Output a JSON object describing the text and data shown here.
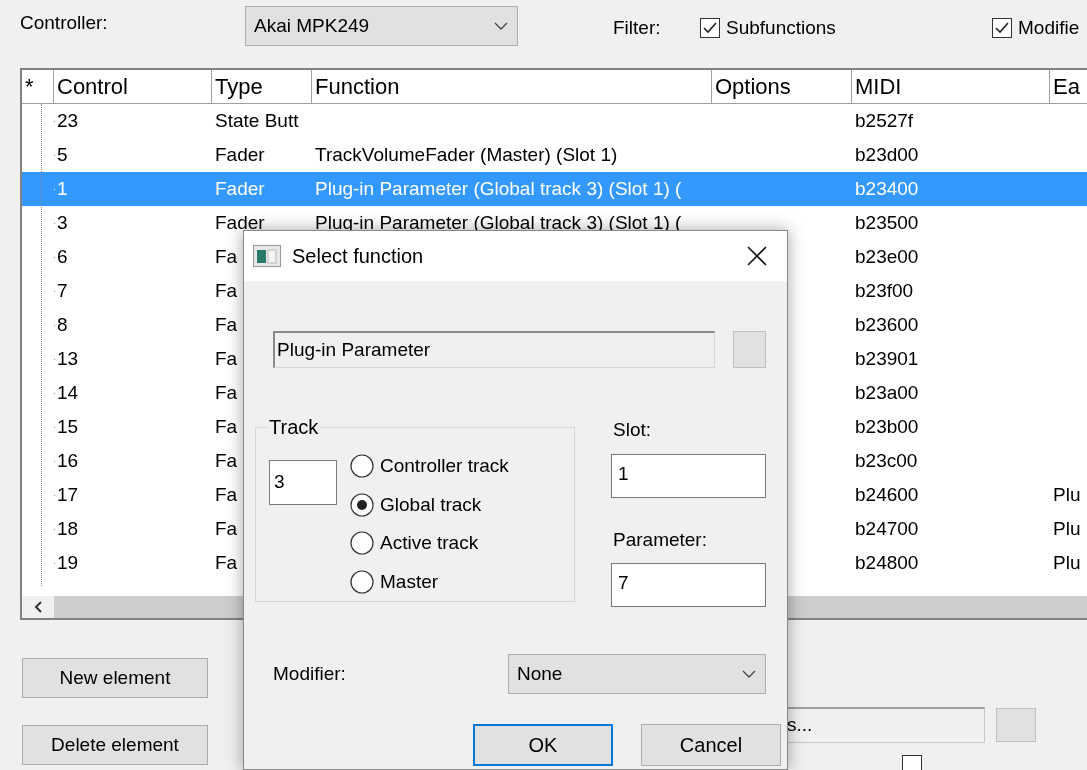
{
  "controller": {
    "label": "Controller:",
    "value": "Akai MPK249"
  },
  "filter": {
    "label": "Filter:",
    "options": [
      {
        "label": "Subfunctions",
        "checked": true
      },
      {
        "label": "Modifie",
        "checked": true
      }
    ]
  },
  "table": {
    "columns": [
      "*",
      "Control",
      "Type",
      "Function",
      "Options",
      "MIDI",
      "Ea"
    ],
    "rows": [
      {
        "cells": [
          "",
          "23",
          "State Butt",
          "",
          "",
          "b2527f",
          ""
        ],
        "selected": false
      },
      {
        "cells": [
          "",
          "5",
          "Fader",
          "TrackVolumeFader (Master) (Slot 1)",
          "",
          "b23d00",
          ""
        ],
        "selected": false
      },
      {
        "cells": [
          "",
          "1",
          "Fader",
          "Plug-in Parameter (Global track 3) (Slot 1) (",
          "",
          "b23400",
          ""
        ],
        "selected": true
      },
      {
        "cells": [
          "",
          "3",
          "Fader",
          "Plug-in Parameter (Global track 3) (Slot 1) (",
          "",
          "b23500",
          ""
        ],
        "selected": false
      },
      {
        "cells": [
          "",
          "6",
          "Fa",
          "",
          "",
          "b23e00",
          ""
        ],
        "selected": false
      },
      {
        "cells": [
          "",
          "7",
          "Fa",
          "",
          "",
          "b23f00",
          ""
        ],
        "selected": false
      },
      {
        "cells": [
          "",
          "8",
          "Fa",
          "",
          "",
          "b23600",
          ""
        ],
        "selected": false
      },
      {
        "cells": [
          "",
          "13",
          "Fa",
          "",
          "",
          "b23901",
          ""
        ],
        "selected": false
      },
      {
        "cells": [
          "",
          "14",
          "Fa",
          "",
          "",
          "b23a00",
          ""
        ],
        "selected": false
      },
      {
        "cells": [
          "",
          "15",
          "Fa",
          "",
          "",
          "b23b00",
          ""
        ],
        "selected": false
      },
      {
        "cells": [
          "",
          "16",
          "Fa",
          "",
          "",
          "b23c00",
          ""
        ],
        "selected": false
      },
      {
        "cells": [
          "",
          "17",
          "Fa",
          "",
          "",
          "b24600",
          "Plu"
        ],
        "selected": false
      },
      {
        "cells": [
          "",
          "18",
          "Fa",
          "",
          "",
          "b24700",
          "Plu"
        ],
        "selected": false
      },
      {
        "cells": [
          "",
          "19",
          "Fa",
          "",
          "",
          "b24800",
          "Plu"
        ],
        "selected": false
      }
    ]
  },
  "buttons": [
    "New element",
    "Delete element"
  ],
  "function_field": {
    "value": "s..."
  },
  "slot_checkbox": {
    "checked": false
  },
  "dialog": {
    "title": "Select function",
    "function_value": "Plug-in Parameter",
    "track": {
      "label": "Track",
      "value": "3",
      "options": [
        {
          "label": "Controller track",
          "selected": false
        },
        {
          "label": "Global track",
          "selected": true
        },
        {
          "label": "Active track",
          "selected": false
        },
        {
          "label": "Master",
          "selected": false
        }
      ]
    },
    "slot": {
      "label": "Slot:",
      "value": "1"
    },
    "parameter": {
      "label": "Parameter:",
      "value": "7"
    },
    "modifier": {
      "label": "Modifier:",
      "value": "None"
    },
    "buttons": [
      {
        "label": "OK",
        "default": true
      },
      {
        "label": "Cancel",
        "default": false
      }
    ]
  }
}
